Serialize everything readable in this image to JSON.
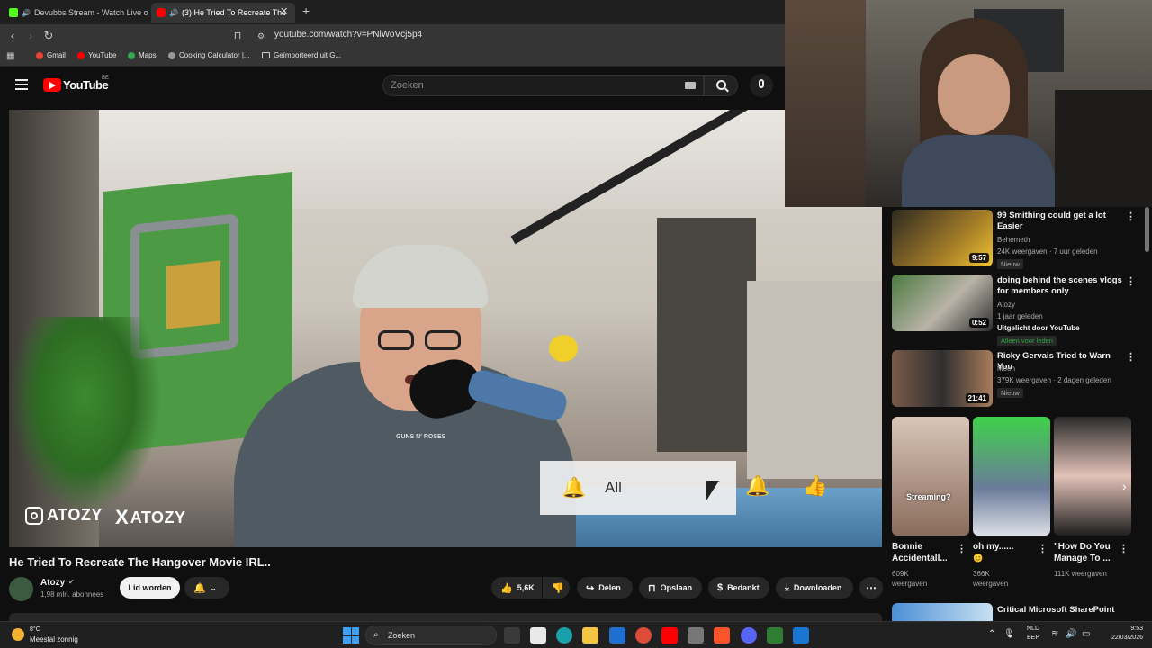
{
  "browser": {
    "tabs": [
      {
        "title": "Devubbs Stream - Watch Live on"
      },
      {
        "title": "(3) He Tried To Recreate The"
      }
    ],
    "url": "youtube.com/watch?v=PNlWoVcj5p4",
    "bookmarks": [
      "Gmail",
      "YouTube",
      "Maps",
      "Cooking Calculator |...",
      "Geïmporteerd uit G..."
    ]
  },
  "youtube": {
    "logo_text": "YouTube",
    "region": "BE",
    "search_placeholder": "Zoeken"
  },
  "video": {
    "overlay_instagram": "ATOZY",
    "overlay_x": "ATOZY",
    "notification_label": "All",
    "title": "He Tried To Recreate The Hangover Movie IRL..",
    "channel": "Atozy",
    "subscribers": "1,98 mln. abonnees",
    "join_label": "Lid worden",
    "likes": "5,6K",
    "share_label": "Delen",
    "save_label": "Opslaan",
    "thanks_label": "Bedankt",
    "download_label": "Downloaden"
  },
  "recommendations": [
    {
      "title": "99 Smithing could get a lot Easier",
      "channel": "Behemeth",
      "meta": "24K weergaven · 7 uur geleden",
      "badge": "Nieuw",
      "duration": "9:57"
    },
    {
      "title": "doing behind the scenes vlogs for members only",
      "channel": "Atozy",
      "meta": "1 jaar geleden",
      "extra": "Uitgelicht door YouTube",
      "badge": "Alleen voor leden",
      "duration": "0:52"
    },
    {
      "title": "Ricky Gervais Tried to Warn You",
      "channel": "Moon",
      "meta": "379K weergaven · 2 dagen geleden",
      "badge": "Nieuw",
      "duration": "21:41"
    }
  ],
  "shorts": [
    {
      "title": "Bonnie Accidentall...",
      "views": "609K weergaven",
      "overlay": "Streaming?"
    },
    {
      "title": "oh my......",
      "views": "366K weergaven"
    },
    {
      "title": "\"How Do You Manage To ...",
      "views": "111K weergaven"
    }
  ],
  "next_title": "Critical Microsoft SharePoint",
  "taskbar": {
    "weather_temp": "8°C",
    "weather_desc": "Meestal zonnig",
    "search_label": "Zoeken",
    "lang_top": "NLD",
    "lang_bottom": "BEP",
    "time": "9:53",
    "date": "22/03/2026"
  },
  "colors": {
    "youtube_red": "#ff0000",
    "background": "#0f0f0f",
    "pill": "#272727",
    "taskbar": "#202020"
  }
}
